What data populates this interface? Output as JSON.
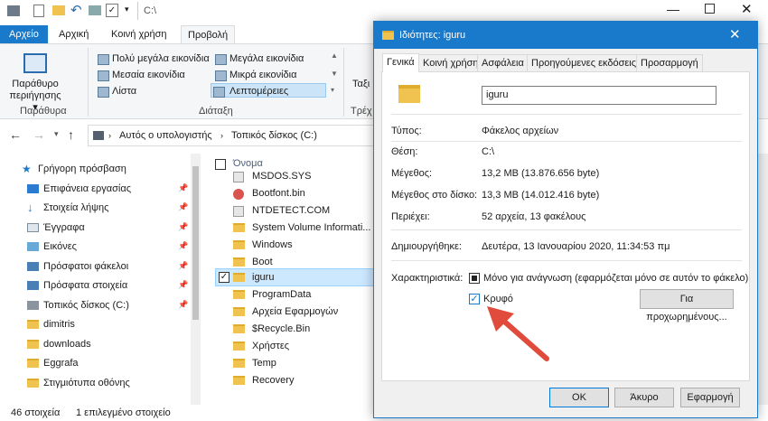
{
  "titlebar": {
    "path": "C:\\"
  },
  "ribbon": {
    "tabs": [
      "Αρχείο",
      "Αρχική",
      "Κοινή χρήση",
      "Προβολή"
    ],
    "preview_pane": "Παράθυρο",
    "preview_pane2": "περιήγησης",
    "group_panes": "Παράθυρα",
    "layout": {
      "xl": "Πολύ μεγάλα εικονίδια",
      "large": "Μεγάλα εικονίδια",
      "medium": "Μεσαία εικονίδια",
      "small": "Μικρά εικονίδια",
      "list": "Λίστα",
      "details": "Λεπτομέρειες"
    },
    "group_layout": "Διάταξη",
    "partial1": "Ταξι",
    "partial2": "Τρέχ"
  },
  "address": {
    "crumbs": [
      "Αυτός ο υπολογιστής",
      "Τοπικός δίσκος (C:)"
    ]
  },
  "nav": {
    "items": [
      {
        "label": "Γρήγορη πρόσβαση",
        "icon": "star-icon"
      },
      {
        "label": "Επιφάνεια εργασίας",
        "icon": "desktop-icon"
      },
      {
        "label": "Στοιχεία λήψης",
        "icon": "download-icon"
      },
      {
        "label": "Έγγραφα",
        "icon": "documents-icon"
      },
      {
        "label": "Εικόνες",
        "icon": "pictures-icon"
      },
      {
        "label": "Πρόσφατοι φάκελοι",
        "icon": "recent-icon"
      },
      {
        "label": "Πρόσφατα στοιχεία",
        "icon": "recent-icon"
      },
      {
        "label": "Τοπικός δίσκος (C:)",
        "icon": "drive-icon"
      },
      {
        "label": "dimitris",
        "icon": "folder-icon"
      },
      {
        "label": "downloads",
        "icon": "folder-icon"
      },
      {
        "label": "Eggrafa",
        "icon": "folder-icon"
      },
      {
        "label": "Στιγμιότυπα οθόνης",
        "icon": "folder-icon"
      }
    ]
  },
  "files": {
    "header": "Όνομα",
    "items": [
      "MSDOS.SYS",
      "Bootfont.bin",
      "NTDETECT.COM",
      "System Volume Informati...",
      "Windows",
      "Boot",
      "iguru",
      "ProgramData",
      "Αρχεία Εφαρμογών",
      "$Recycle.Bin",
      "Χρήστες",
      "Temp",
      "Recovery"
    ]
  },
  "status": {
    "count": "46 στοιχεία",
    "selected": "1 επιλεγμένο στοιχείο"
  },
  "dialog": {
    "title": "Ιδιότητες: iguru",
    "tabs": [
      "Γενικά",
      "Κοινή χρήση",
      "Ασφάλεια",
      "Προηγούμενες εκδόσεις",
      "Προσαρμογή"
    ],
    "name": "iguru",
    "rows": [
      {
        "label": "Τύπος:",
        "value": "Φάκελος αρχείων"
      },
      {
        "label": "Θέση:",
        "value": "C:\\"
      },
      {
        "label": "Μέγεθος:",
        "value": "13,2 MB (13.876.656 byte)"
      },
      {
        "label": "Μέγεθος στο δίσκο:",
        "value": "13,3 MB (14.012.416 byte)"
      },
      {
        "label": "Περιέχει:",
        "value": "52 αρχεία, 13 φακέλους"
      },
      {
        "label": "Δημιουργήθηκε:",
        "value": "Δευτέρα, 13 Ιανουαρίου 2020, 11:34:53 πμ"
      }
    ],
    "attr_label": "Χαρακτηριστικά:",
    "readonly": "Μόνο για ανάγνωση (εφαρμόζεται μόνο σε αυτόν το φάκελο)",
    "hidden": "Κρυφό",
    "advanced": "Για προχωρημένους...",
    "ok": "OK",
    "cancel": "Άκυρο",
    "apply": "Εφαρμογή"
  }
}
